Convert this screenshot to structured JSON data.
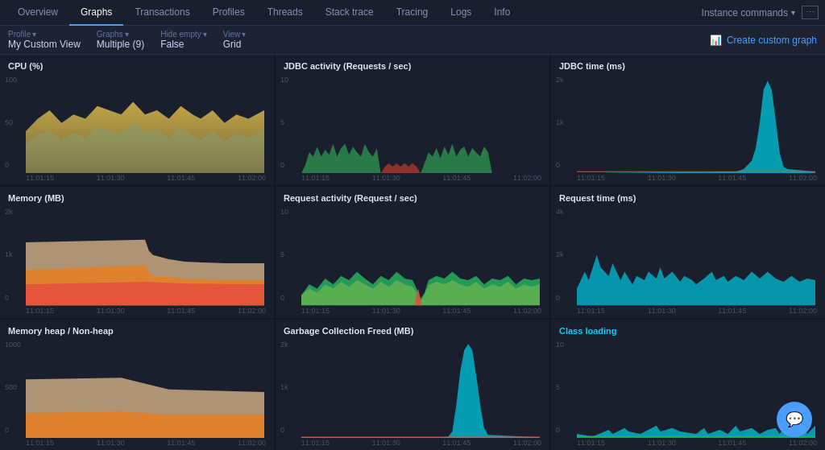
{
  "nav": {
    "tabs": [
      {
        "label": "Overview",
        "active": false
      },
      {
        "label": "Graphs",
        "active": true
      },
      {
        "label": "Transactions",
        "active": false
      },
      {
        "label": "Profiles",
        "active": false
      },
      {
        "label": "Threads",
        "active": false
      },
      {
        "label": "Stack trace",
        "active": false
      },
      {
        "label": "Tracing",
        "active": false
      },
      {
        "label": "Logs",
        "active": false
      },
      {
        "label": "Info",
        "active": false
      }
    ],
    "instance_commands": "Instance commands"
  },
  "subnav": {
    "profile_label": "Profile",
    "profile_value": "My Custom View",
    "graphs_label": "Graphs",
    "graphs_value": "Multiple (9)",
    "hide_empty_label": "Hide empty",
    "hide_empty_value": "False",
    "view_label": "View",
    "view_value": "Grid",
    "create_graph_label": "Create custom graph"
  },
  "charts": [
    {
      "id": "cpu",
      "title": "CPU (%)",
      "title_color": "normal",
      "y_labels": [
        "100",
        "50",
        "0"
      ],
      "x_labels": [
        "11:01:15",
        "11:01:30",
        "11:01:45",
        "11:02:00"
      ],
      "type": "cpu"
    },
    {
      "id": "jdbc-activity",
      "title": "JDBC activity (Requests / sec)",
      "title_color": "normal",
      "y_labels": [
        "10",
        "5",
        "0"
      ],
      "x_labels": [
        "11:01:15",
        "11:01:30",
        "11:01:45",
        "11:02:00"
      ],
      "type": "jdbc-activity"
    },
    {
      "id": "jdbc-time",
      "title": "JDBC time (ms)",
      "title_color": "normal",
      "y_labels": [
        "2k",
        "1k",
        "0"
      ],
      "x_labels": [
        "11:01:15",
        "11:01:30",
        "11:01:45",
        "11:02:00"
      ],
      "type": "jdbc-time"
    },
    {
      "id": "memory",
      "title": "Memory (MB)",
      "title_color": "normal",
      "y_labels": [
        "2k",
        "1k",
        "0"
      ],
      "x_labels": [
        "11:01:15",
        "11:01:30",
        "11:01:45",
        "11:02:00"
      ],
      "type": "memory"
    },
    {
      "id": "request-activity",
      "title": "Request activity (Request / sec)",
      "title_color": "normal",
      "y_labels": [
        "10",
        "5",
        "0"
      ],
      "x_labels": [
        "11:01:15",
        "11:01:30",
        "11:01:45",
        "11:02:00"
      ],
      "type": "request-activity"
    },
    {
      "id": "request-time",
      "title": "Request time (ms)",
      "title_color": "normal",
      "y_labels": [
        "4k",
        "2k",
        "0"
      ],
      "x_labels": [
        "11:01:15",
        "11:01:30",
        "11:01:45",
        "11:02:00"
      ],
      "type": "request-time"
    },
    {
      "id": "memory-heap",
      "title": "Memory heap / Non-heap",
      "title_color": "normal",
      "y_labels": [
        "1000",
        "500",
        "0"
      ],
      "x_labels": [
        "11:01:15",
        "11:01:30",
        "11:01:45",
        "11:02:00"
      ],
      "type": "memory-heap"
    },
    {
      "id": "gc-freed",
      "title": "Garbage Collection Freed (MB)",
      "title_color": "normal",
      "y_labels": [
        "2k",
        "1k",
        "0"
      ],
      "x_labels": [
        "11:01:15",
        "11:01:30",
        "11:01:45",
        "11:02:00"
      ],
      "type": "gc-freed"
    },
    {
      "id": "class-loading",
      "title": "Class loading",
      "title_color": "cyan",
      "y_labels": [
        "10",
        "5",
        "0"
      ],
      "x_labels": [
        "11:01:15",
        "11:01:30",
        "11:01:45",
        "11:02:00"
      ],
      "type": "class-loading"
    }
  ]
}
